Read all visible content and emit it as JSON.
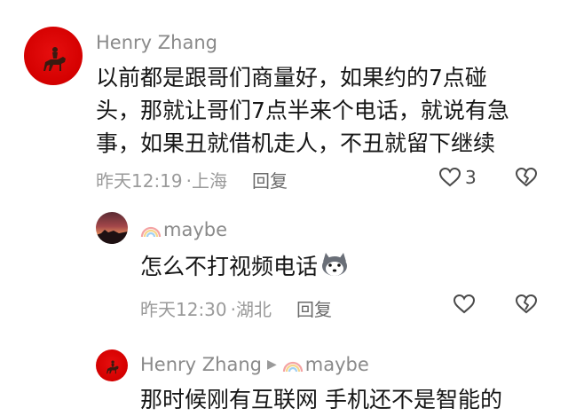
{
  "comments": [
    {
      "author": "Henry Zhang",
      "lines": [
        "以前都是跟哥们商量好，如果约的7点碰",
        "头，那就让哥们7点半来个电话，就说有急",
        "事，如果丑就借机走人，不丑就留下继续"
      ],
      "time": "昨天12:19",
      "location": "上海",
      "reply_label": "回复",
      "likes": "3"
    },
    {
      "author": "maybe",
      "text": "怎么不打视频电话",
      "time": "昨天12:30",
      "location": "湖北",
      "reply_label": "回复"
    },
    {
      "author": "Henry Zhang",
      "reply_to": "maybe",
      "text": "那时候刚有互联网 手机还不是智能的"
    }
  ],
  "colors": {
    "accent_red": "#d40000",
    "meta_gray": "#9a9a9a"
  }
}
